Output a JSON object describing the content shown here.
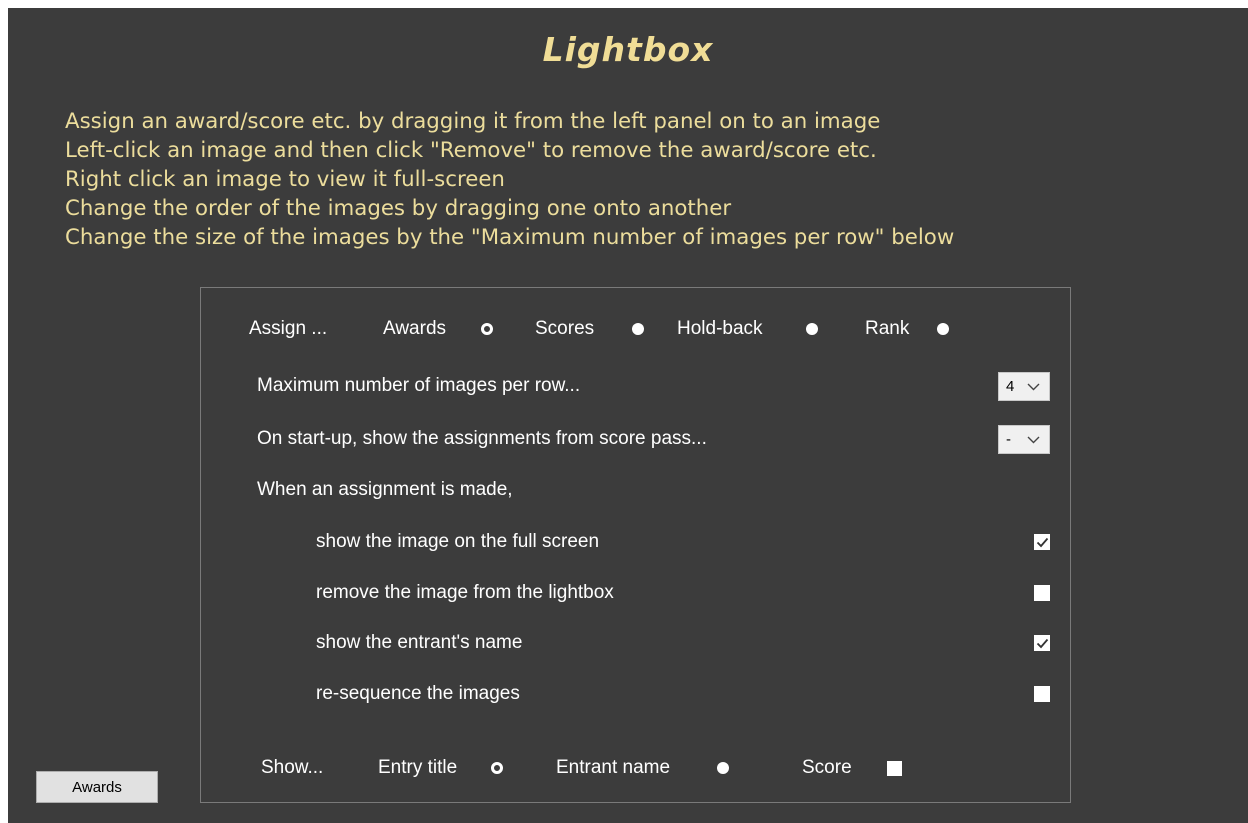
{
  "title": "Lightbox",
  "instructions": [
    "Assign an award/score etc. by dragging it from the left panel on to an image",
    "Left-click an image and then click \"Remove\" to remove the award/score etc.",
    "Right click an image to view it full-screen",
    "Change the order of the images by dragging one onto another",
    "Change the size of the images by the \"Maximum number of images per row\" below"
  ],
  "assign": {
    "label": "Assign ...",
    "options": [
      {
        "label": "Awards",
        "selected": true
      },
      {
        "label": "Scores",
        "selected": false
      },
      {
        "label": "Hold-back",
        "selected": false
      },
      {
        "label": "Rank",
        "selected": false
      }
    ]
  },
  "max_per_row": {
    "label": "Maximum number of images per row...",
    "value": "4"
  },
  "startup_pass": {
    "label": "On start-up, show the assignments from score pass...",
    "value": "-"
  },
  "assignment_heading": "When an assignment is made,",
  "checkbox_options": [
    {
      "label": "show the image on the full screen",
      "checked": true
    },
    {
      "label": "remove the image from the lightbox",
      "checked": false
    },
    {
      "label": "show the entrant's name",
      "checked": true
    },
    {
      "label": "re-sequence the images",
      "checked": false
    }
  ],
  "show": {
    "label": "Show...",
    "entry_title": {
      "label": "Entry title",
      "selected": true
    },
    "entrant_name": {
      "label": "Entrant name",
      "selected": false
    },
    "score": {
      "label": "Score",
      "checked": false
    }
  },
  "awards_button": "Awards",
  "colors": {
    "background": "#3c3c3c",
    "title": "#f0dd96",
    "instructions": "#ecdd9c",
    "text": "#ffffff"
  }
}
